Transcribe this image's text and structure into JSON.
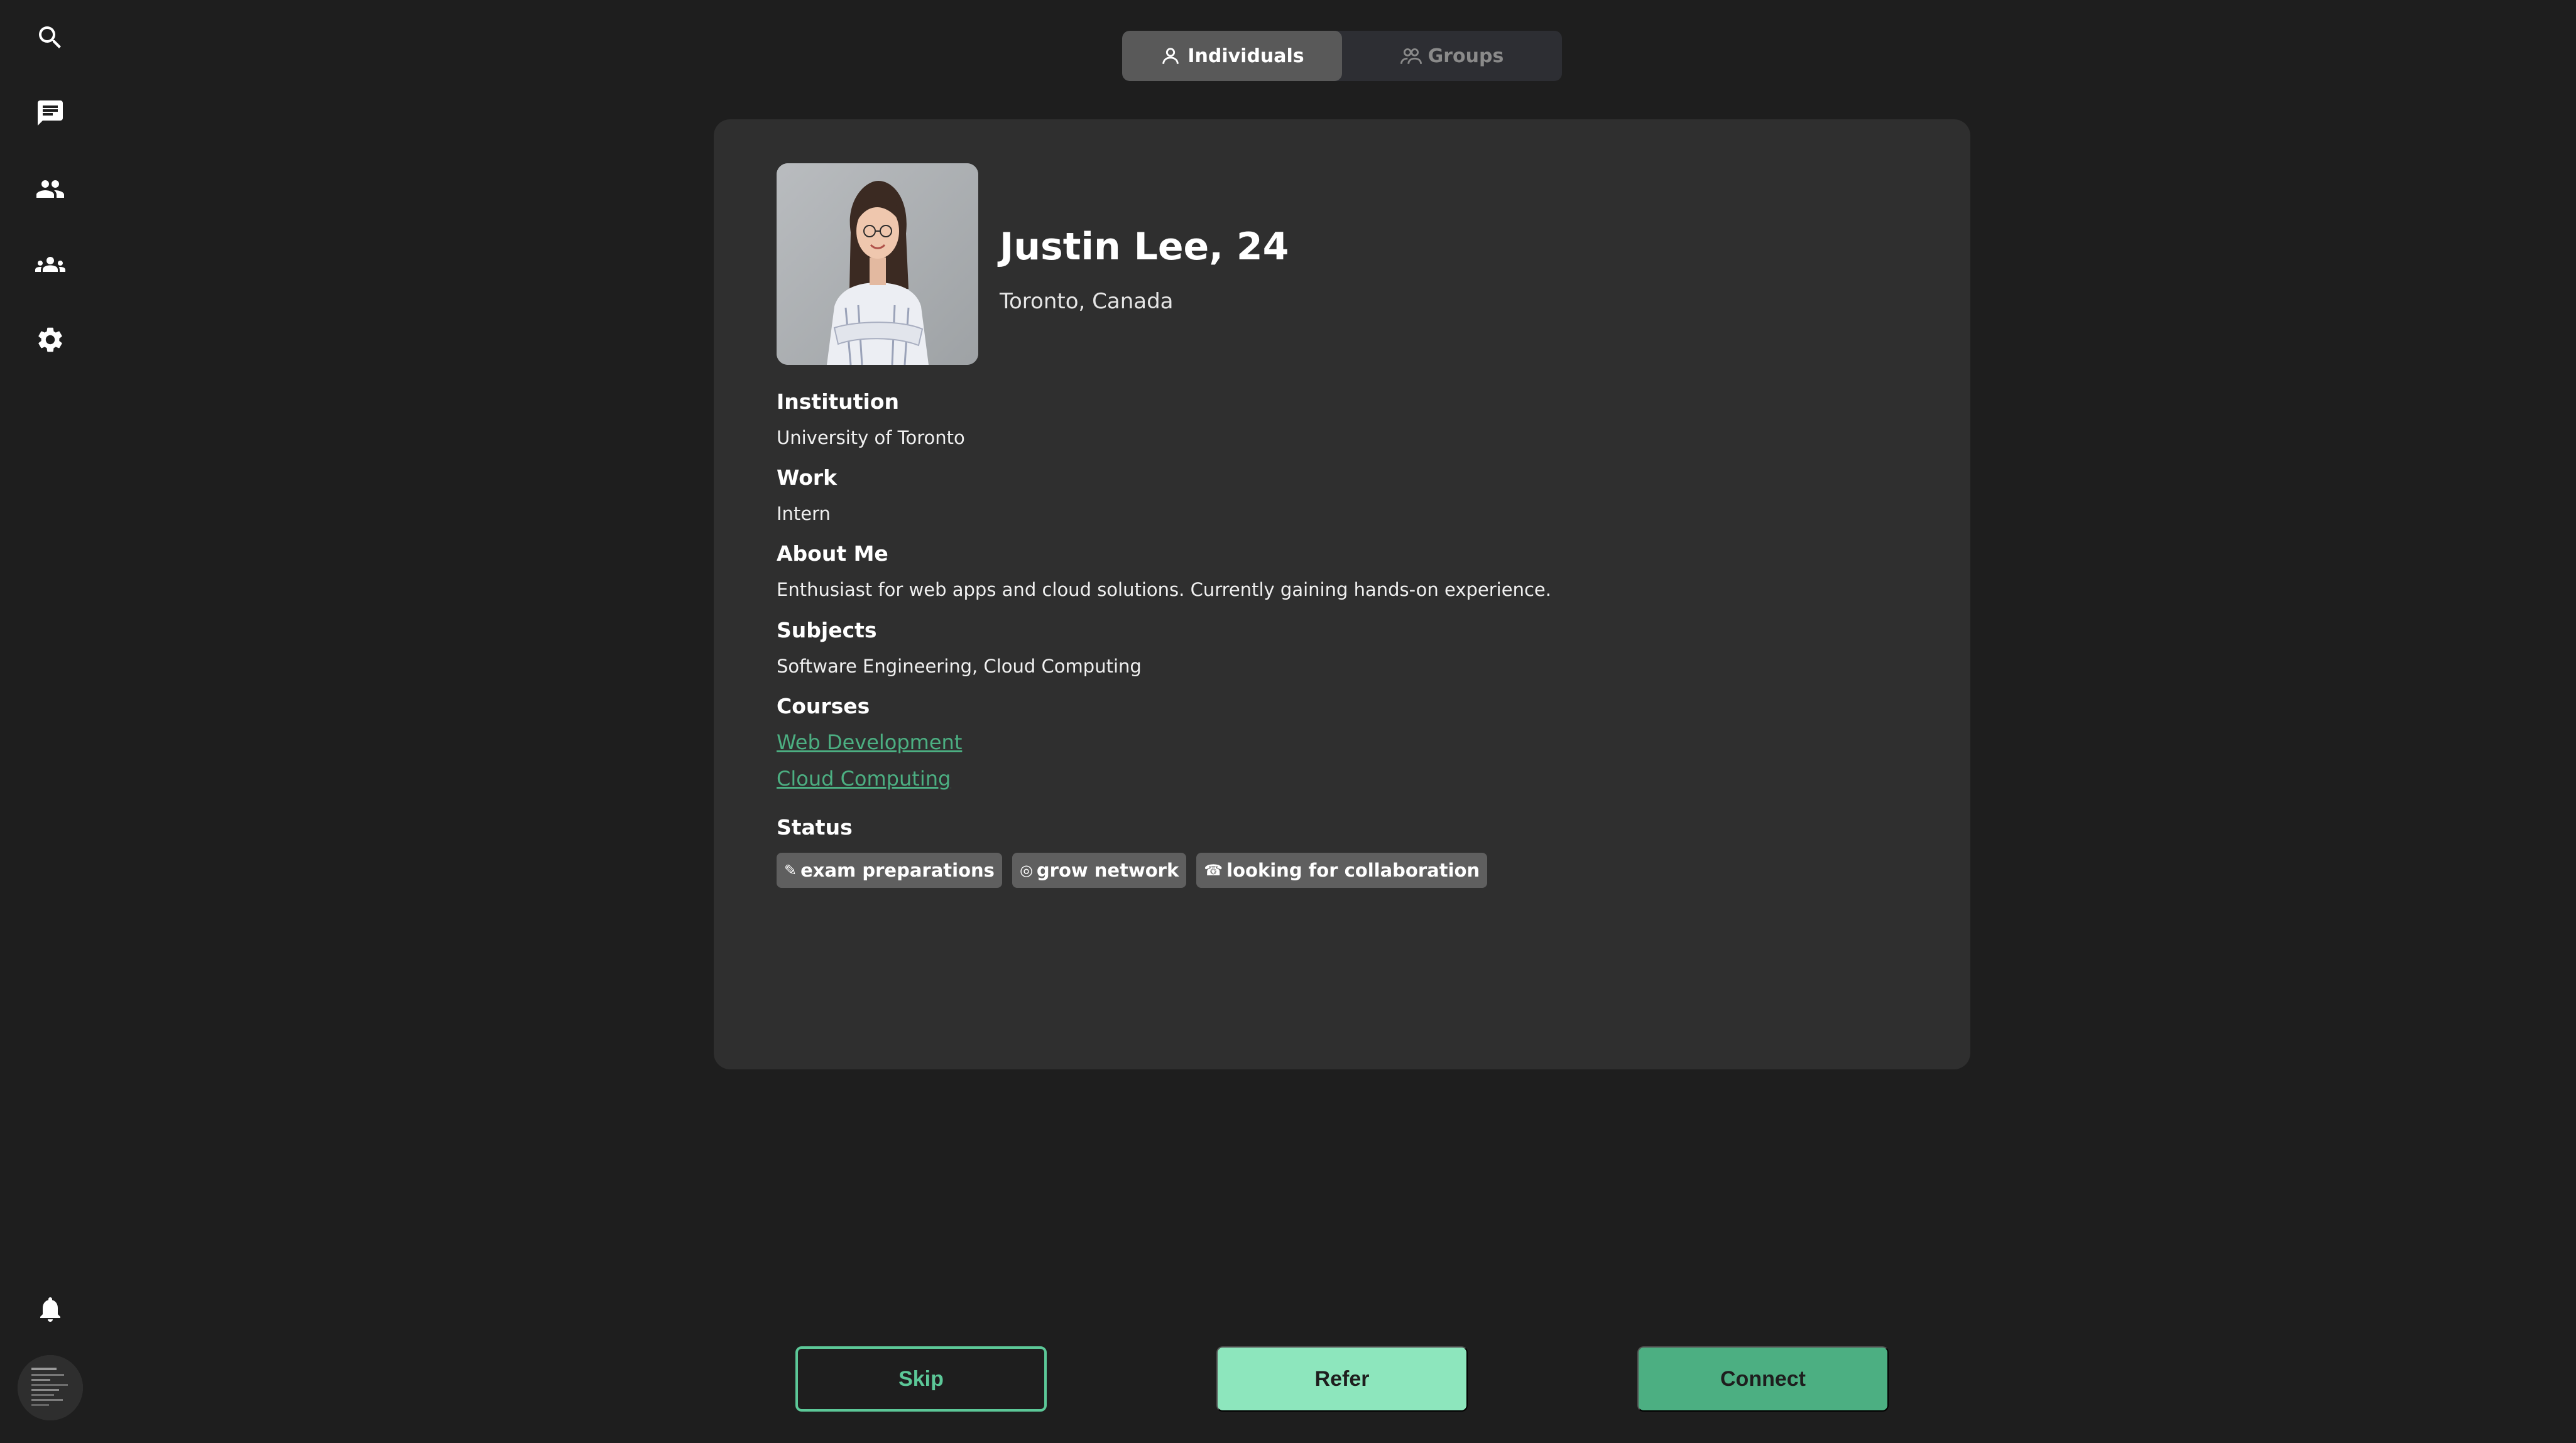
{
  "tabs": {
    "individuals": "Individuals",
    "groups": "Groups"
  },
  "profile": {
    "name": "Justin Lee, 24",
    "location": "Toronto, Canada",
    "fields": {
      "institution_label": "Institution",
      "institution_value": "University of Toronto",
      "work_label": "Work",
      "work_value": "Intern",
      "about_label": "About Me",
      "about_value": "Enthusiast for web apps and cloud solutions. Currently gaining hands-on experience.",
      "subjects_label": "Subjects",
      "subjects_value": "Software Engineering, Cloud Computing",
      "courses_label": "Courses",
      "courses": [
        "Web Development",
        "Cloud Computing"
      ],
      "status_label": "Status",
      "status": [
        {
          "icon": "✎",
          "label": "exam preparations"
        },
        {
          "icon": "◎",
          "label": "grow network"
        },
        {
          "icon": "☎",
          "label": "looking for collaboration"
        }
      ]
    }
  },
  "actions": {
    "skip": "Skip",
    "refer": "Refer",
    "connect": "Connect"
  },
  "colors": {
    "accent": "#4caf82",
    "accent_light": "#8de6bd",
    "background": "#1e1e1e",
    "card": "#2f2f2f"
  },
  "sidebar_icons": [
    "search-icon",
    "chat-icon",
    "people-icon",
    "groups-icon",
    "settings-icon",
    "bell-icon"
  ]
}
